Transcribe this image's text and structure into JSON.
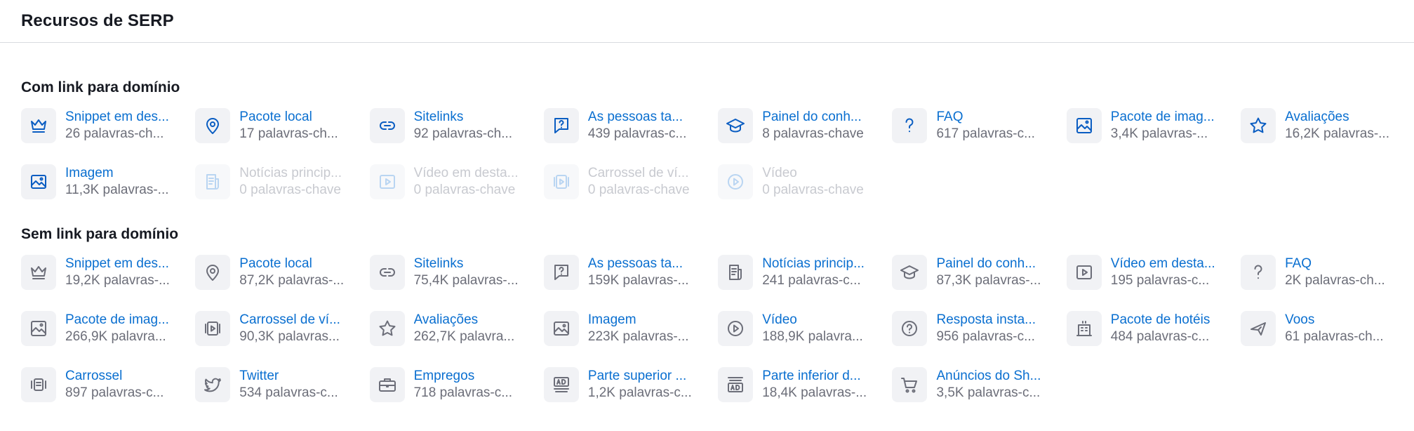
{
  "page_title": "Recursos de SERP",
  "sections": [
    {
      "title": "Com link para domínio",
      "items": [
        {
          "label": "Snippet em des...",
          "count": "26 palavras-ch...",
          "icon": "crown-icon",
          "disabled": false
        },
        {
          "label": "Pacote local",
          "count": "17 palavras-ch...",
          "icon": "map-pin-icon",
          "disabled": false
        },
        {
          "label": "Sitelinks",
          "count": "92 palavras-ch...",
          "icon": "link-icon",
          "disabled": false
        },
        {
          "label": "As pessoas ta...",
          "count": "439 palavras-c...",
          "icon": "question-bubble-icon",
          "disabled": false
        },
        {
          "label": "Painel do conh...",
          "count": "8 palavras-chave",
          "icon": "graduation-cap-icon",
          "disabled": false
        },
        {
          "label": "FAQ",
          "count": "617 palavras-c...",
          "icon": "question-mark-icon",
          "disabled": false
        },
        {
          "label": "Pacote de imag...",
          "count": "3,4K palavras-...",
          "icon": "image-stack-icon",
          "disabled": false
        },
        {
          "label": "Avaliações",
          "count": "16,2K palavras-...",
          "icon": "star-icon",
          "disabled": false
        },
        {
          "label": "Imagem",
          "count": "11,3K palavras-...",
          "icon": "image-icon",
          "disabled": false
        },
        {
          "label": "Notícias princip...",
          "count": "0 palavras-chave",
          "icon": "news-icon",
          "disabled": true
        },
        {
          "label": "Vídeo em desta...",
          "count": "0 palavras-chave",
          "icon": "video-frame-icon",
          "disabled": true
        },
        {
          "label": "Carrossel de ví...",
          "count": "0 palavras-chave",
          "icon": "video-carousel-icon",
          "disabled": true
        },
        {
          "label": "Vídeo",
          "count": "0 palavras-chave",
          "icon": "play-circle-icon",
          "disabled": true
        }
      ]
    },
    {
      "title": "Sem link para domínio",
      "items": [
        {
          "label": "Snippet em des...",
          "count": "19,2K palavras-...",
          "icon": "crown-icon",
          "disabled": false
        },
        {
          "label": "Pacote local",
          "count": "87,2K palavras-...",
          "icon": "map-pin-icon",
          "disabled": false
        },
        {
          "label": "Sitelinks",
          "count": "75,4K palavras-...",
          "icon": "link-icon",
          "disabled": false
        },
        {
          "label": "As pessoas ta...",
          "count": "159K palavras-...",
          "icon": "question-bubble-icon",
          "disabled": false
        },
        {
          "label": "Notícias princip...",
          "count": "241 palavras-c...",
          "icon": "news-icon",
          "disabled": false
        },
        {
          "label": "Painel do conh...",
          "count": "87,3K palavras-...",
          "icon": "graduation-cap-icon",
          "disabled": false
        },
        {
          "label": "Vídeo em desta...",
          "count": "195 palavras-c...",
          "icon": "video-frame-icon",
          "disabled": false
        },
        {
          "label": "FAQ",
          "count": "2K palavras-ch...",
          "icon": "question-mark-icon",
          "disabled": false
        },
        {
          "label": "Pacote de imag...",
          "count": "266,9K palavra...",
          "icon": "image-stack-icon",
          "disabled": false
        },
        {
          "label": "Carrossel de ví...",
          "count": "90,3K palavras...",
          "icon": "video-carousel-icon",
          "disabled": false
        },
        {
          "label": "Avaliações",
          "count": "262,7K palavra...",
          "icon": "star-icon",
          "disabled": false
        },
        {
          "label": "Imagem",
          "count": "223K palavras-...",
          "icon": "image-icon",
          "disabled": false
        },
        {
          "label": "Vídeo",
          "count": "188,9K palavra...",
          "icon": "play-circle-icon",
          "disabled": false
        },
        {
          "label": "Resposta insta...",
          "count": "956 palavras-c...",
          "icon": "question-circle-icon",
          "disabled": false
        },
        {
          "label": "Pacote de hotéis",
          "count": "484 palavras-c...",
          "icon": "hotel-icon",
          "disabled": false
        },
        {
          "label": "Voos",
          "count": "61 palavras-ch...",
          "icon": "plane-icon",
          "disabled": false
        },
        {
          "label": "Carrossel",
          "count": "897 palavras-c...",
          "icon": "carousel-icon",
          "disabled": false
        },
        {
          "label": "Twitter",
          "count": "534 palavras-c...",
          "icon": "twitter-icon",
          "disabled": false
        },
        {
          "label": "Empregos",
          "count": "718 palavras-c...",
          "icon": "briefcase-icon",
          "disabled": false
        },
        {
          "label": "Parte superior ...",
          "count": "1,2K palavras-c...",
          "icon": "ad-top-icon",
          "disabled": false
        },
        {
          "label": "Parte inferior d...",
          "count": "18,4K palavras-...",
          "icon": "ad-bottom-icon",
          "disabled": false
        },
        {
          "label": "Anúncios do Sh...",
          "count": "3,5K palavras-c...",
          "icon": "shopping-cart-icon",
          "disabled": false
        }
      ]
    }
  ]
}
